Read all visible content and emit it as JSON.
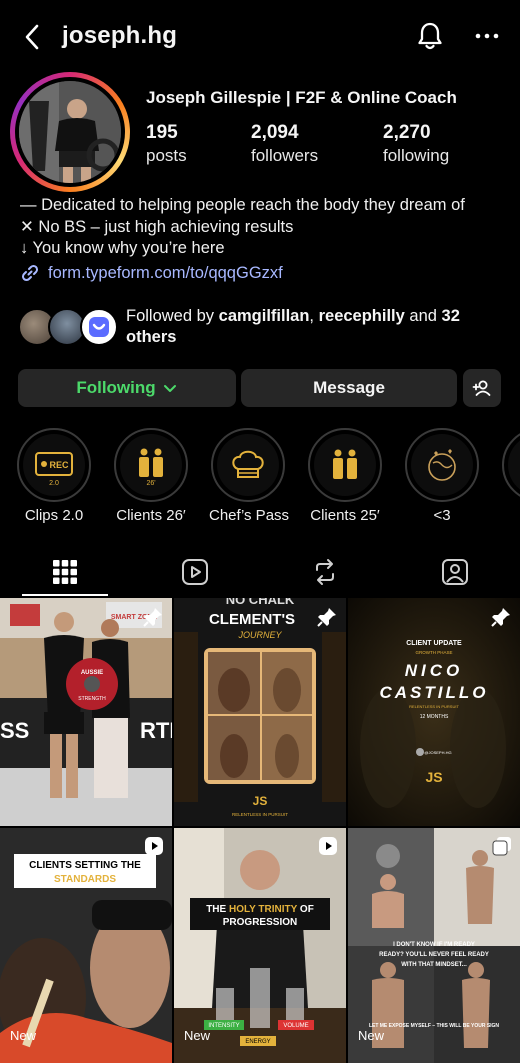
{
  "header": {
    "username": "joseph.hg"
  },
  "profile": {
    "full_name": "Joseph Gillespie | F2F & Online Coach",
    "stats": {
      "posts": {
        "value": "195",
        "label": "posts"
      },
      "followers": {
        "value": "2,094",
        "label": "followers"
      },
      "following": {
        "value": "2,270",
        "label": "following"
      }
    },
    "bio_lines": [
      "— Dedicated to helping people reach the body they dream of",
      "✕ No BS – just high achieving results",
      "↓ You know why you’re here"
    ],
    "link": "form.typeform.com/to/qqqGGzxf",
    "followed_by": {
      "prefix": "Followed by ",
      "user1": "camgilfillan",
      "sep": ", ",
      "user2": "reecephilly",
      "and": " and ",
      "others": "32 others"
    }
  },
  "actions": {
    "following_label": "Following",
    "message_label": "Message"
  },
  "highlights": [
    {
      "label": "Clips 2.0",
      "icon": "rec-icon",
      "badge": "2.0"
    },
    {
      "label": "Clients 26′",
      "icon": "people-icon",
      "badge": "26'"
    },
    {
      "label": "Chef’s Pass",
      "icon": "chef-hat-icon",
      "badge": ""
    },
    {
      "label": "Clients 25′",
      "icon": "people-icon",
      "badge": ""
    },
    {
      "label": "<3",
      "icon": "globe-hearts-icon",
      "badge": ""
    }
  ],
  "grid": {
    "post2": {
      "top_text": "NO CHALK",
      "title": "CLEMENT'S",
      "subtitle": "JOURNEY",
      "footer": "RELENTLESS IN PURSUIT"
    },
    "post3": {
      "kicker": "CLIENT UPDATE",
      "phase": "GROWTH PHASE",
      "name1": "NICO",
      "name2": "CASTILLO",
      "tag": "RELENTLESS IN PURSUIT",
      "months": "12 MONTHS",
      "handle": "@JOSEPH.HG"
    },
    "post4": {
      "line1": "CLIENTS SETTING THE",
      "line2": "STANDARDS",
      "new_label": "New"
    },
    "post5": {
      "line1a": "THE ",
      "line1b": "HOLY TRINITY",
      "line1c": " OF",
      "line2": "PROGRESSION",
      "tag1": "INTENSITY",
      "tag2": "ENERGY",
      "tag3": "VOLUME",
      "new_label": "New"
    },
    "post6": {
      "line1": "I DON'T KNOW IF I'M READY",
      "line2": "READY? YOU'LL NEVER FEEL READY",
      "line3": "WITH THAT MINDSET...",
      "bottom": "LET ME EXPOSE MYSELF – THIS WILL BE YOUR SIGN",
      "new_label": "New"
    },
    "post1": {
      "sign": "SMART ZONE",
      "plate1": "AUSSIE",
      "plate2": "STRENGTH",
      "wall_left": "SS",
      "wall_right": "RTI"
    }
  },
  "colors": {
    "following_green": "#4cd96a",
    "link_blue": "#a8b8ff",
    "button_bg": "#262626",
    "highlight_gold": "#e3b23c"
  }
}
